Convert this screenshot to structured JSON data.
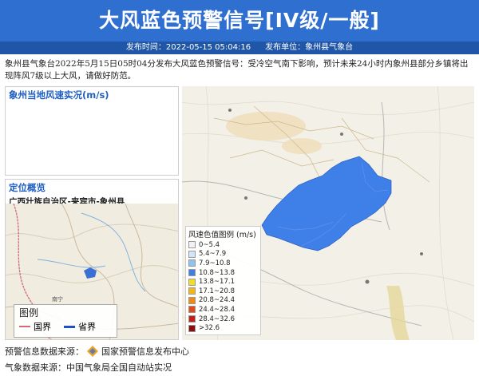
{
  "header": {
    "title": "大风蓝色预警信号[IV级/一般]",
    "publish_time": "发布时间：2022-05-15 05:04:16",
    "publisher": "发布单位：象州县气象台"
  },
  "description": "象州县气象台2022年5月15日05时04分发布大风蓝色预警信号：受冷空气南下影响，预计未来24小时内象州县部分乡镇将出现阵风7级以上大风，请做好防范。",
  "wind_panel": {
    "title": "象州当地风速实况(m/s)"
  },
  "location_panel": {
    "title": "定位概览",
    "subtitle": "广西壮族自治区-来宾市-象州县",
    "legend_title": "图例",
    "legend_border": "国界",
    "legend_province": "省界",
    "place_label": "南宁"
  },
  "wind_scale": {
    "title": "风速色值图例 (m/s)",
    "items": [
      {
        "label": "0~5.4",
        "color": "#f2f2f2"
      },
      {
        "label": "5.4~7.9",
        "color": "#cfe6fb"
      },
      {
        "label": "7.9~10.8",
        "color": "#8ec3f2"
      },
      {
        "label": "10.8~13.8",
        "color": "#3d7fe6"
      },
      {
        "label": "13.8~17.1",
        "color": "#f4dd2a"
      },
      {
        "label": "17.1~20.8",
        "color": "#f6b51a"
      },
      {
        "label": "20.8~24.4",
        "color": "#f08a12"
      },
      {
        "label": "24.4~28.4",
        "color": "#e24a1a"
      },
      {
        "label": "28.4~32.6",
        "color": "#c4201a"
      },
      {
        "label": ">32.6",
        "color": "#8a0f0f"
      }
    ]
  },
  "footer": {
    "source1": "预警信息数据来源：",
    "source1_org": "国家预警信息发布中心",
    "source2": "气象数据来源：中国气象局全国自动站实况"
  },
  "colors": {
    "title_bg": "#2f6fd0",
    "warning_area": "#3f7fe8"
  }
}
